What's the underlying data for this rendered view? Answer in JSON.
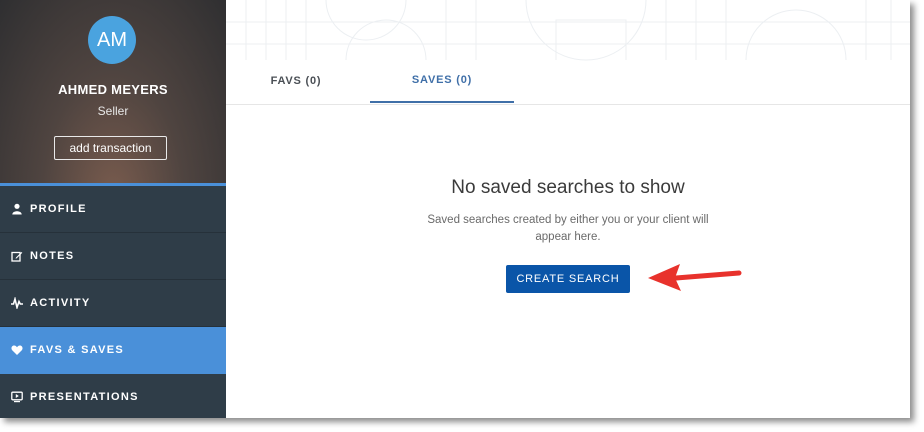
{
  "profile": {
    "initials": "AM",
    "name": "AHMED MEYERS",
    "role": "Seller",
    "add_transaction_label": "add transaction",
    "avatar_color": "#4aa3df"
  },
  "nav": {
    "items": [
      {
        "label": "PROFILE",
        "icon": "user-icon"
      },
      {
        "label": "NOTES",
        "icon": "edit-icon"
      },
      {
        "label": "ACTIVITY",
        "icon": "activity-icon"
      },
      {
        "label": "FAVS & SAVES",
        "icon": "heart-icon",
        "active": true
      },
      {
        "label": "PRESENTATIONS",
        "icon": "presentation-icon"
      }
    ]
  },
  "tabs": {
    "favs_label": "FAVS (0)",
    "saves_label": "SAVES (0)",
    "active": "saves"
  },
  "empty_state": {
    "title": "No saved searches to show",
    "description": "Saved searches created by either you or your client will appear here.",
    "create_button_label": "CREATE SEARCH"
  },
  "colors": {
    "sidebar": "#2f3d48",
    "accent": "#4a90d9",
    "primary_button": "#0a55a8",
    "annotation_arrow": "#e8322c"
  }
}
